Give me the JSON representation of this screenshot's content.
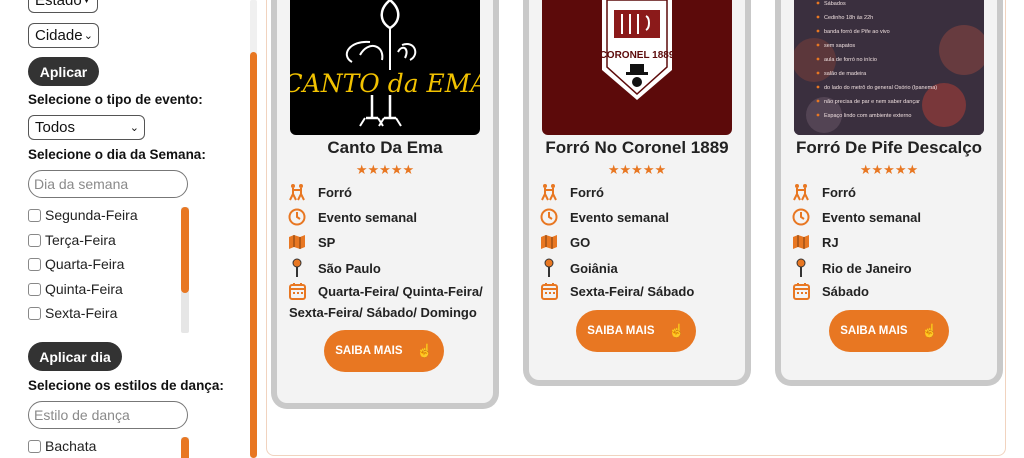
{
  "sidebar": {
    "estado_value": "Estado",
    "cidade_value": "Cidade",
    "aplicar_label": "Aplicar",
    "tipo_evento_label": "Selecione o tipo de evento:",
    "tipo_evento_value": "Todos",
    "dia_semana_label": "Selecione o dia da Semana:",
    "dia_semana_placeholder": "Dia da semana",
    "days": [
      "Segunda-Feira",
      "Terça-Feira",
      "Quarta-Feira",
      "Quinta-Feira",
      "Sexta-Feira"
    ],
    "aplicar_dia_label": "Aplicar dia",
    "estilos_label": "Selecione os estilos de dança:",
    "estilo_placeholder": "Estilo de dança",
    "styles": [
      "Bachata"
    ]
  },
  "cards": [
    {
      "title": "Canto Da Ema",
      "rating": "★★★★★",
      "dance": "Forró",
      "frequency": "Evento semanal",
      "state": "SP",
      "city": "São Paulo",
      "days_line1": "Quarta-Feira/ Quinta-Feira/",
      "days_line2": "Sexta-Feira/ Sábado/ Domingo",
      "button": "SAIBA MAIS",
      "logo_text": "CANTO da EMA"
    },
    {
      "title": "Forró No Coronel 1889",
      "rating": "★★★★★",
      "dance": "Forró",
      "frequency": "Evento semanal",
      "state": "GO",
      "city": "Goiânia",
      "days_line1": "Sexta-Feira/ Sábado",
      "button": "SAIBA MAIS",
      "logo_text": "CORONEL 1889"
    },
    {
      "title": "Forró De Pife Descalço",
      "rating": "★★★★★",
      "dance": "Forró",
      "frequency": "Evento semanal",
      "state": "RJ",
      "city": "Rio de Janeiro",
      "days_line1": "Sábado",
      "button": "SAIBA MAIS",
      "poster_lines": [
        "Sábados",
        "Cedinho 18h às 22h",
        "banda forró de Pife ao vivo",
        "sem sapatos",
        "aula de forró no início",
        "salão de madeira",
        "do lado do metrô do general Osório (Ipanema)",
        "não precisa de par e nem saber dançar",
        "Espaço lindo com ambiente externo"
      ]
    }
  ],
  "colors": {
    "accent": "#e87722",
    "dark_button": "#333333",
    "card_bg": "#f3f3f3",
    "card_border": "#c9c9c9"
  }
}
